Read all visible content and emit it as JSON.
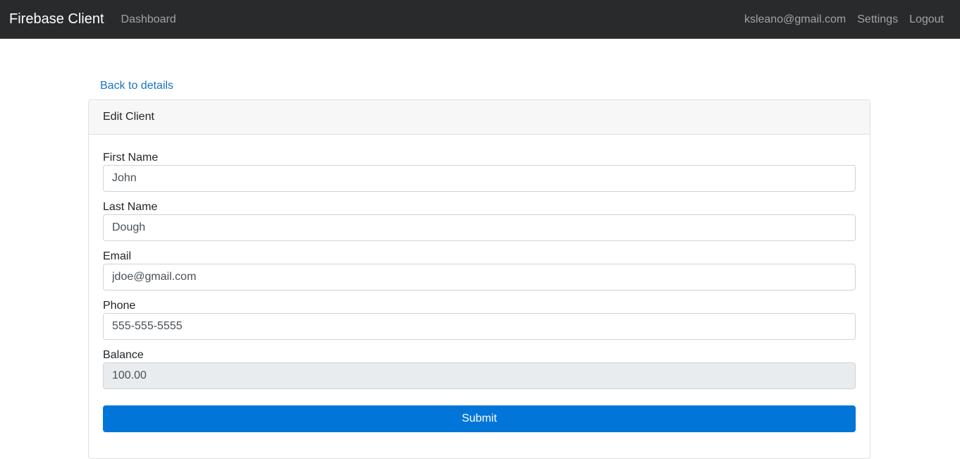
{
  "navbar": {
    "brand": "Firebase Client",
    "dashboard_label": "Dashboard",
    "user_email": "ksleano@gmail.com",
    "settings_label": "Settings",
    "logout_label": "Logout"
  },
  "back_link": "Back to details",
  "card": {
    "header": "Edit Client",
    "fields": {
      "first_name": {
        "label": "First Name",
        "value": "John"
      },
      "last_name": {
        "label": "Last Name",
        "value": "Dough"
      },
      "email": {
        "label": "Email",
        "value": "jdoe@gmail.com"
      },
      "phone": {
        "label": "Phone",
        "value": "555-555-5555"
      },
      "balance": {
        "label": "Balance",
        "value": "100.00"
      }
    },
    "submit_label": "Submit"
  },
  "colors": {
    "navbar_bg": "#292a2c",
    "link": "#1a73c2",
    "primary_button": "#0275d8",
    "disabled_input": "#e9ecef"
  }
}
